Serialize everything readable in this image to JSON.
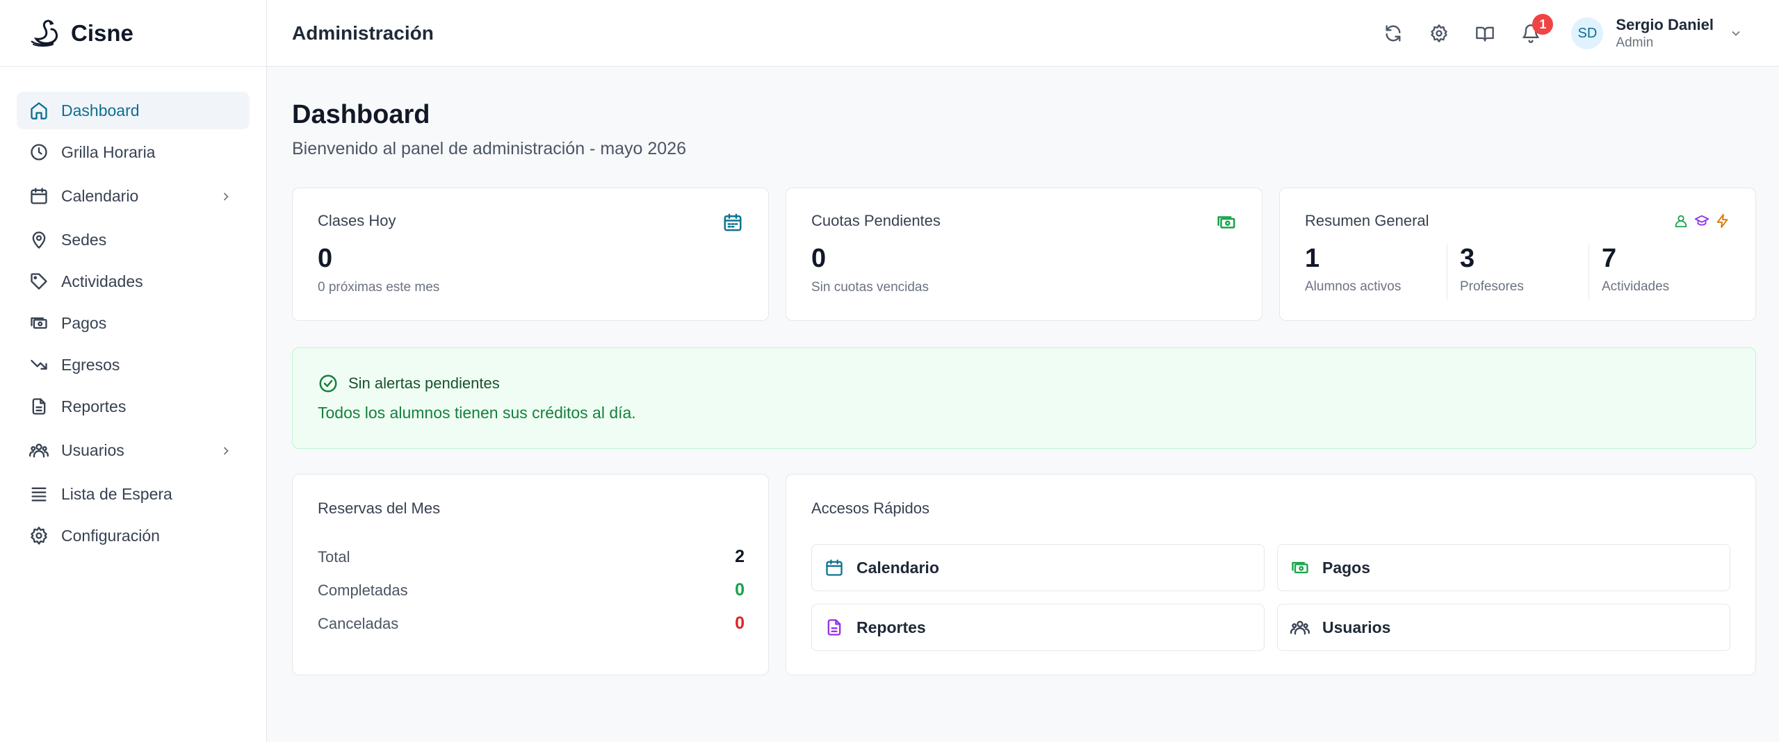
{
  "brand": {
    "name": "Cisne"
  },
  "sidebar": {
    "items": [
      {
        "label": "Dashboard",
        "icon": "home-icon",
        "active": true
      },
      {
        "label": "Grilla Horaria",
        "icon": "clock-icon"
      },
      {
        "label": "Calendario",
        "icon": "calendar-icon",
        "expandable": true
      },
      {
        "label": "Sedes",
        "icon": "map-pin-icon"
      },
      {
        "label": "Actividades",
        "icon": "tag-icon"
      },
      {
        "label": "Pagos",
        "icon": "banknote-icon"
      },
      {
        "label": "Egresos",
        "icon": "trending-down-icon"
      },
      {
        "label": "Reportes",
        "icon": "file-text-icon"
      },
      {
        "label": "Usuarios",
        "icon": "users-icon",
        "expandable": true
      },
      {
        "label": "Lista de Espera",
        "icon": "list-icon"
      },
      {
        "label": "Configuración",
        "icon": "gear-icon"
      }
    ]
  },
  "header": {
    "title": "Administración",
    "notifications_count": "1",
    "user": {
      "initials": "SD",
      "name": "Sergio Daniel",
      "role": "Admin"
    }
  },
  "page": {
    "title": "Dashboard",
    "subtitle": "Bienvenido al panel de administración - mayo 2026"
  },
  "cards": {
    "clases_hoy": {
      "label": "Clases Hoy",
      "value": "0",
      "sub": "0 próximas este mes"
    },
    "cuotas": {
      "label": "Cuotas Pendientes",
      "value": "0",
      "sub": "Sin cuotas vencidas"
    },
    "resumen": {
      "label": "Resumen General",
      "items": [
        {
          "value": "1",
          "label": "Alumnos activos"
        },
        {
          "value": "3",
          "label": "Profesores"
        },
        {
          "value": "7",
          "label": "Actividades"
        }
      ]
    }
  },
  "alert": {
    "title": "Sin alertas pendientes",
    "body": "Todos los alumnos tienen sus créditos al día."
  },
  "reservas": {
    "label": "Reservas del Mes",
    "rows": [
      {
        "label": "Total",
        "value": "2",
        "color": "#111827"
      },
      {
        "label": "Completadas",
        "value": "0",
        "color": "#16a34a"
      },
      {
        "label": "Canceladas",
        "value": "0",
        "color": "#dc2626"
      }
    ]
  },
  "accesos": {
    "label": "Accesos Rápidos",
    "buttons": [
      {
        "label": "Calendario",
        "icon": "calendar-icon",
        "color": "#0e7490"
      },
      {
        "label": "Pagos",
        "icon": "banknote-icon",
        "color": "#16a34a"
      },
      {
        "label": "Reportes",
        "icon": "file-text-icon",
        "color": "#9333ea"
      },
      {
        "label": "Usuarios",
        "icon": "users-icon",
        "color": "#374151"
      }
    ]
  },
  "colors": {
    "accent": "#0e6e91",
    "success": "#16a34a",
    "danger": "#dc2626",
    "purple": "#9333ea",
    "amber": "#d97706"
  }
}
